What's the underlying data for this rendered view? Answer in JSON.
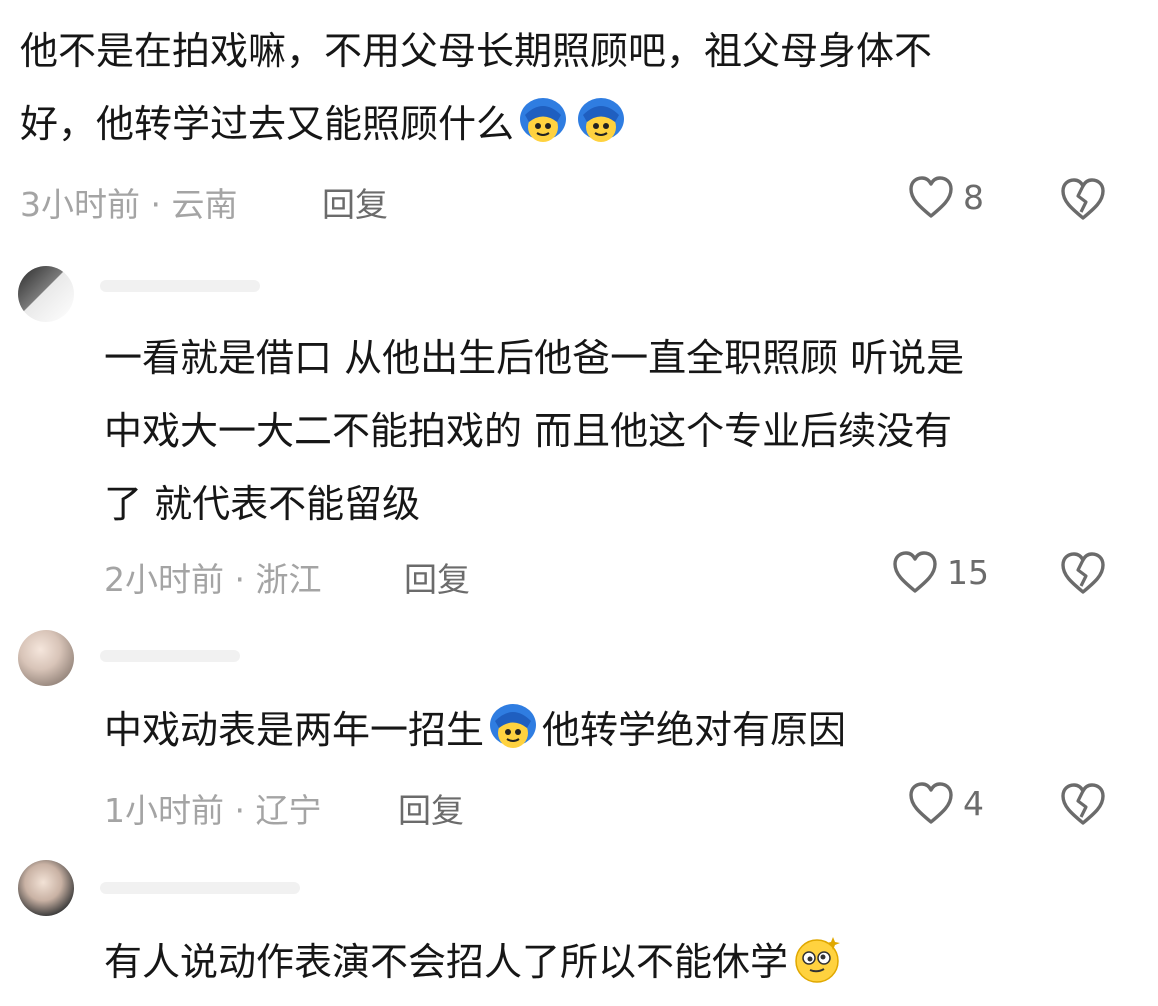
{
  "comments": [
    {
      "lines": [
        "他不是在拍戏嘛，不用父母长期照顾吧，祖父母身体不",
        "好，他转学过去又能照顾什么"
      ],
      "emoji_after": "blue-hair-face-emoji",
      "time": "3小时前",
      "separator": "·",
      "location": "云南",
      "reply_label": "回复",
      "likes": "8"
    },
    {
      "lines": [
        "一看就是借口 从他出生后他爸一直全职照顾  听说是",
        "中戏大一大二不能拍戏的 而且他这个专业后续没有",
        "了 就代表不能留级"
      ],
      "time": "2小时前",
      "separator": "·",
      "location": "浙江",
      "reply_label": "回复",
      "likes": "15"
    },
    {
      "line_before": "中戏动表是两年一招生",
      "line_after": "他转学绝对有原因",
      "emoji_mid": "blue-hair-face-emoji",
      "time": "1小时前",
      "separator": "·",
      "location": "辽宁",
      "reply_label": "回复",
      "likes": "4"
    },
    {
      "line": "有人说动作表演不会招人了所以不能休学",
      "emoji_after": "dizzy-face-emoji"
    }
  ],
  "colors": {
    "text": "#161616",
    "meta": "#a4a4a4",
    "action": "#6b6b6b"
  }
}
